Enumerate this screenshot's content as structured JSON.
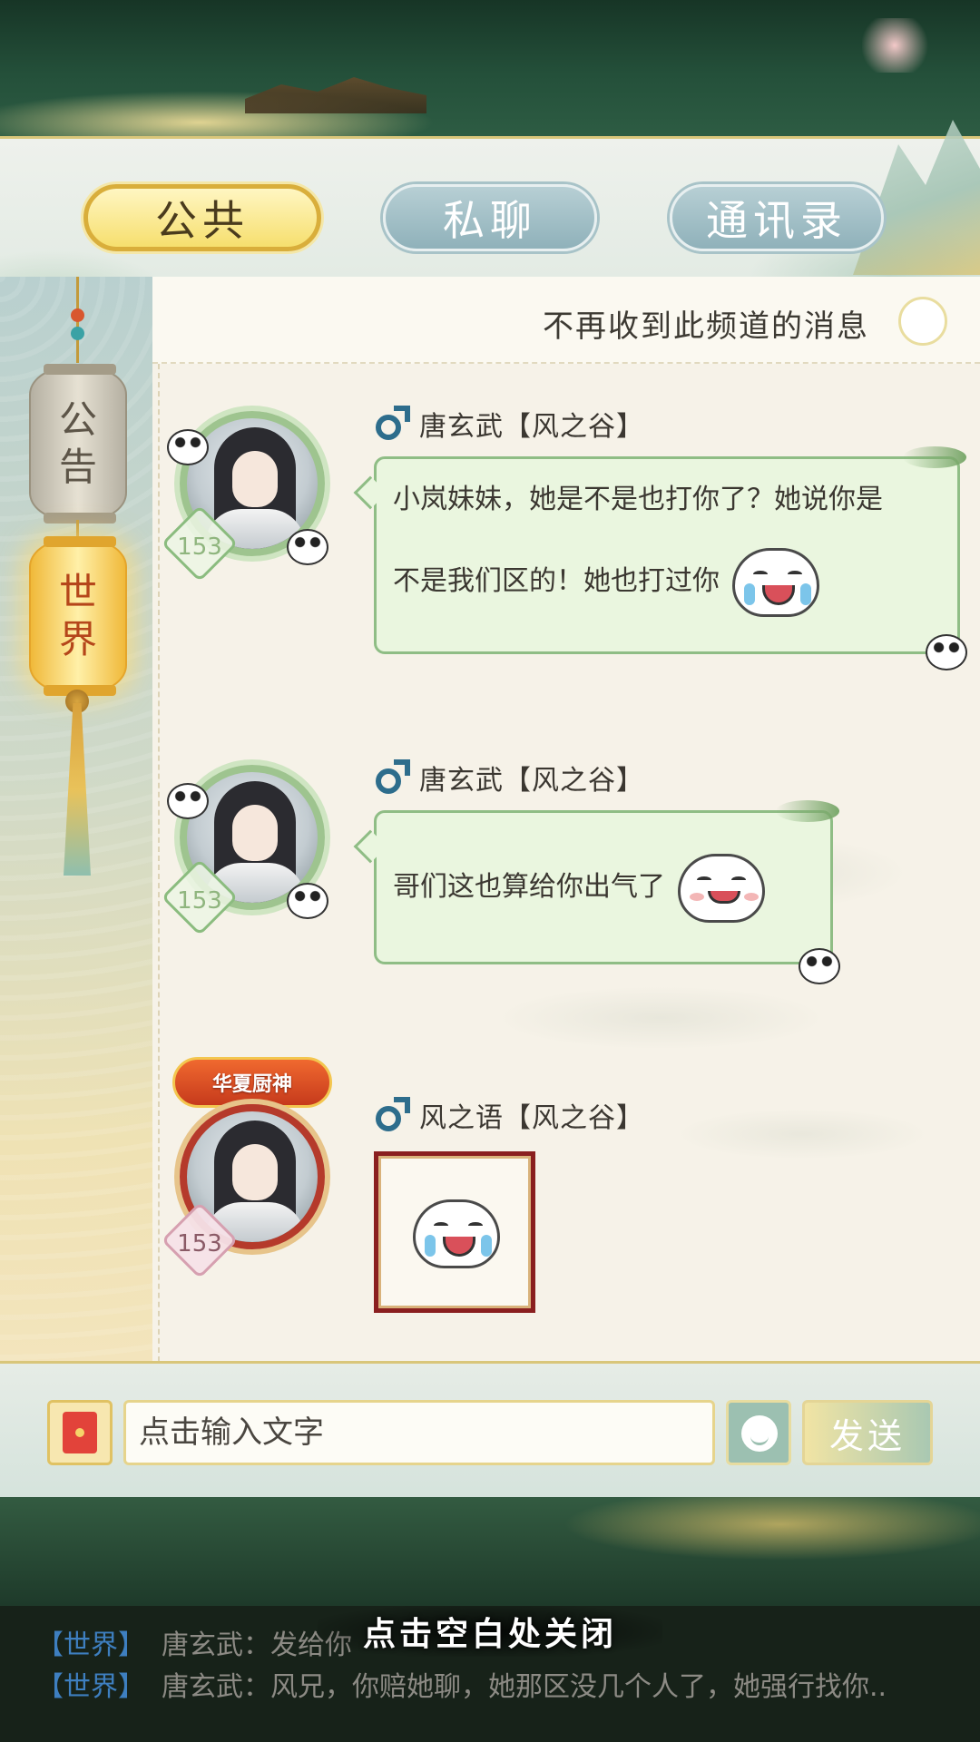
{
  "tabs": [
    {
      "label": "公共",
      "active": true
    },
    {
      "label": "私聊",
      "active": false
    },
    {
      "label": "通讯录",
      "active": false
    }
  ],
  "sidebar": {
    "channels": [
      {
        "label_top": "公",
        "label_bottom": "告",
        "active": false
      },
      {
        "label_top": "世",
        "label_bottom": "界",
        "active": true
      }
    ]
  },
  "chat_header": {
    "mute_label": "不再收到此频道的消息"
  },
  "messages": [
    {
      "sender": "唐玄武【风之谷】",
      "level": "153",
      "gender_icon": "male-icon",
      "text_line1": "小岚妹妹，她是不是也打你了？她说你是",
      "text_line2": "不是我们区的！她也打过你",
      "emoji": "crying-laugh-emoji"
    },
    {
      "sender": "唐玄武【风之谷】",
      "level": "153",
      "gender_icon": "male-icon",
      "text_line1": "哥们这也算给你出气了",
      "emoji": "smirk-emoji"
    },
    {
      "sender": "风之语【风之谷】",
      "level": "153",
      "gender_icon": "male-icon",
      "title_badge": "华夏厨神",
      "sticker": "crying-laugh-emoji"
    }
  ],
  "input_bar": {
    "placeholder": "点击输入文字",
    "send_label": "发送"
  },
  "world_feed": [
    {
      "channel": "【世界】",
      "text": "唐玄武：发给你"
    },
    {
      "channel": "【世界】",
      "text": "唐玄武：风兄，你赔她聊，她那区没几个人了，她强行找你.."
    }
  ],
  "close_hint": "点击空白处关闭",
  "colors": {
    "active_tab": "#f6df6e",
    "inactive_tab": "#8fb1ba",
    "bubble": "#eaf6df",
    "channel_blue": "#3e7fc0"
  }
}
